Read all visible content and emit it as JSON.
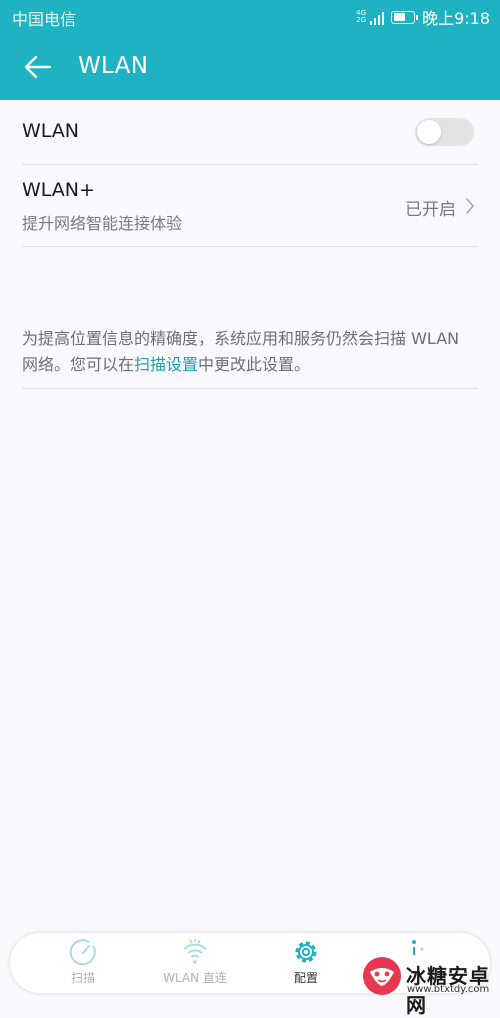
{
  "status": {
    "carrier": "中国电信",
    "network_tag": "4G 2G",
    "battery_level": 0.6,
    "time": "晚上9:18"
  },
  "header": {
    "title": "WLAN",
    "back_icon": "arrow-left-icon"
  },
  "wlan_row": {
    "label": "WLAN",
    "enabled": false
  },
  "wlan_plus_row": {
    "label": "WLAN+",
    "subtitle": "提升网络智能连接体验",
    "value": "已开启"
  },
  "note": {
    "text_before": "为提高位置信息的精确度，系统应用和服务仍然会扫描 WLAN 网络。您可以在",
    "link": "扫描设置",
    "text_after": "中更改此设置。"
  },
  "bottom_nav": {
    "tabs": [
      {
        "label": "扫描",
        "icon": "scan-gauge-icon",
        "active": false
      },
      {
        "label": "WLAN 直连",
        "icon": "wifi-direct-icon",
        "active": false
      },
      {
        "label": "配置",
        "icon": "gear-icon",
        "active": true
      },
      {
        "label": "",
        "icon": "more-icon",
        "active": false
      }
    ]
  },
  "watermark": {
    "name": "冰糖安卓网",
    "url": "www.btxtdy.com"
  },
  "colors": {
    "accent": "#1eb2c3",
    "link": "#1aa3b5",
    "background": "#faf8fc"
  }
}
